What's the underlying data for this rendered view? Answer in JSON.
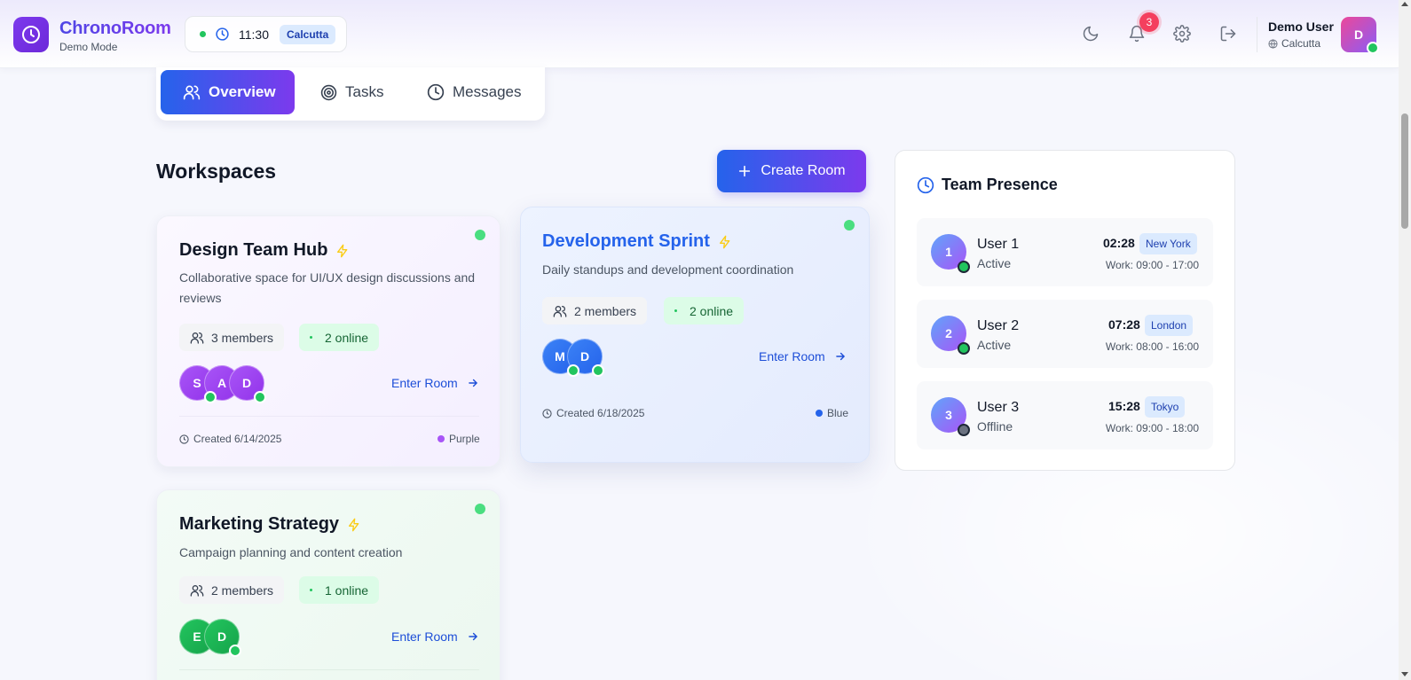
{
  "brand": {
    "title": "ChronoRoom",
    "subtitle": "Demo Mode"
  },
  "clock": {
    "time": "11:30",
    "timezone": "Calcutta"
  },
  "header": {
    "notification_count": "3",
    "user_name": "Demo User",
    "user_location": "Calcutta",
    "user_initial": "D"
  },
  "tabs": [
    {
      "label": "Overview"
    },
    {
      "label": "Tasks"
    },
    {
      "label": "Messages"
    }
  ],
  "workspaces": {
    "title": "Workspaces",
    "create_label": "Create Room",
    "rooms": [
      {
        "name": "Design Team Hub",
        "description": "Collaborative space for UI/UX design discussions and reviews",
        "members": "3 members",
        "online": "2 online",
        "avatars": [
          "S",
          "A",
          "D"
        ],
        "enter_label": "Enter Room",
        "created": "Created 6/14/2025",
        "color_name": "Purple",
        "color": "#9333ea"
      },
      {
        "name": "Development Sprint",
        "description": "Daily standups and development coordination",
        "members": "2 members",
        "online": "2 online",
        "avatars": [
          "M",
          "D"
        ],
        "enter_label": "Enter Room",
        "created": "Created 6/18/2025",
        "color_name": "Blue",
        "color": "#2563eb"
      },
      {
        "name": "Marketing Strategy",
        "description": "Campaign planning and content creation",
        "members": "2 members",
        "online": "1 online",
        "avatars": [
          "E",
          "D"
        ],
        "enter_label": "Enter Room",
        "color": "#16a34a"
      }
    ]
  },
  "presence": {
    "title": "Team Presence",
    "users": [
      {
        "initial": "1",
        "name": "User 1",
        "status": "Active",
        "time": "02:28",
        "city": "New York",
        "work": "Work: 09:00 - 17:00",
        "online": true
      },
      {
        "initial": "2",
        "name": "User 2",
        "status": "Active",
        "time": "07:28",
        "city": "London",
        "work": "Work: 08:00 - 16:00",
        "online": true
      },
      {
        "initial": "3",
        "name": "User 3",
        "status": "Offline",
        "time": "15:28",
        "city": "Tokyo",
        "work": "Work: 09:00 - 18:00",
        "online": false
      }
    ]
  },
  "colors": {
    "accent_start": "#2563eb",
    "accent_end": "#7c3aed",
    "online": "#22c55e",
    "offline": "#6b7280"
  }
}
